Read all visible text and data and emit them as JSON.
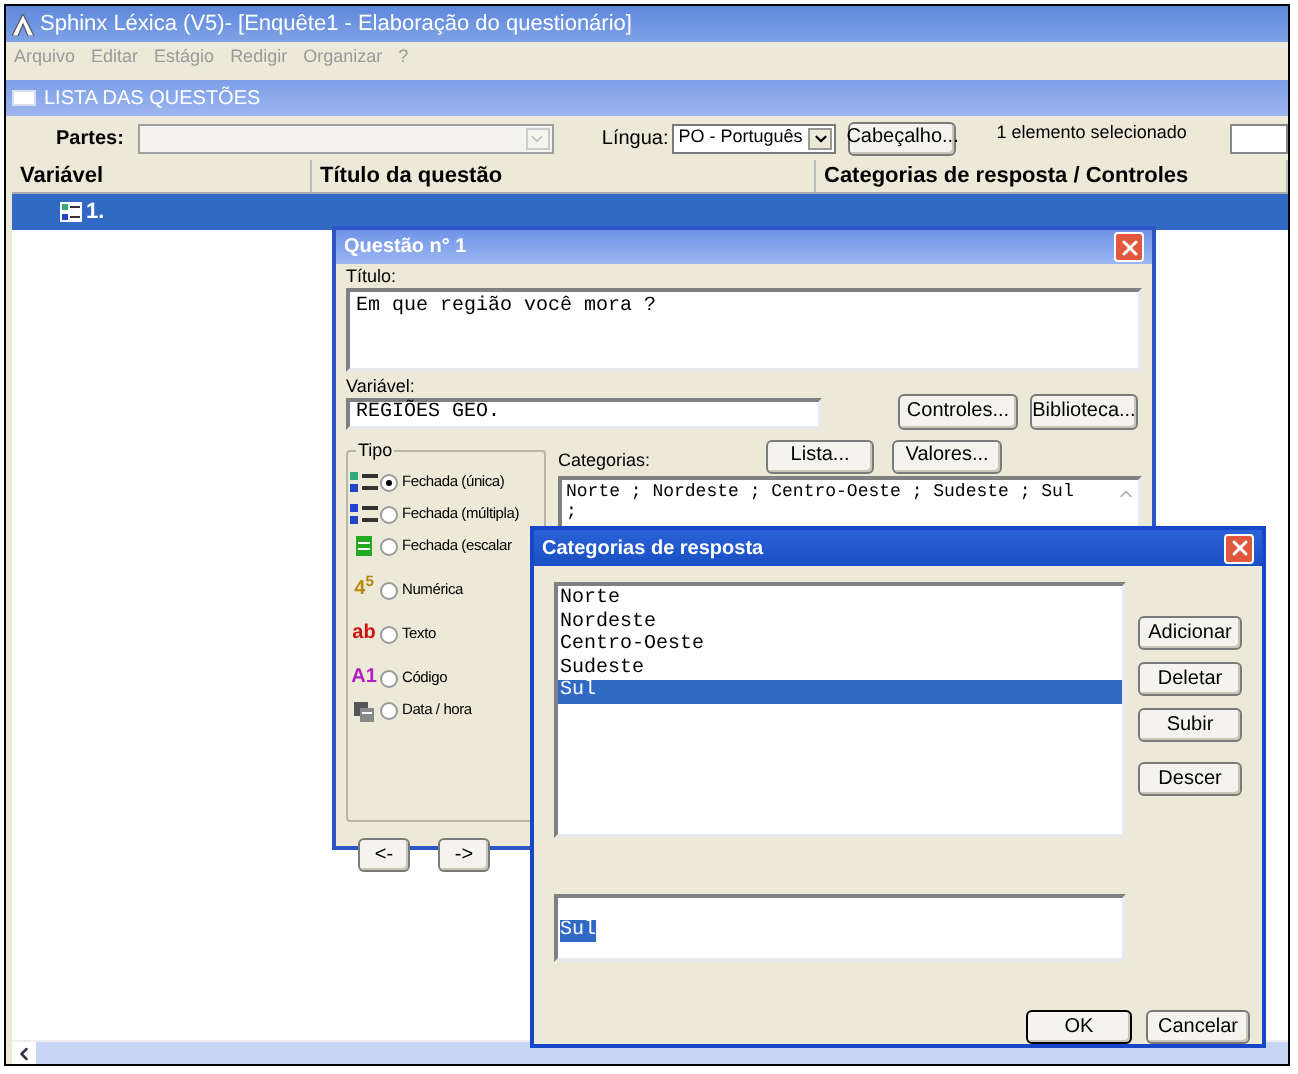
{
  "window": {
    "title": "Sphinx Léxica (V5)- [Enquête1 - Elaboração do questionário]"
  },
  "menu": [
    {
      "label": "Arquivo",
      "disabled": true
    },
    {
      "label": "Editar",
      "disabled": true
    },
    {
      "label": "Estágio",
      "disabled": true
    },
    {
      "label": "Redigir",
      "disabled": true
    },
    {
      "label": "Organizar",
      "disabled": true
    },
    {
      "label": "?",
      "disabled": true
    }
  ],
  "child_window": {
    "title": "LISTA DAS QUESTÕES"
  },
  "toolbar": {
    "parts_label": "Partes:",
    "language_label": "Língua:",
    "language_value": "PO - Português",
    "header_button": "Cabeçalho...",
    "selection_status": "1 elemento selecionado"
  },
  "table": {
    "columns": [
      "Variável",
      "Título da questão",
      "Categorias de resposta / Controles"
    ],
    "rows": [
      {
        "variable": "1.",
        "selected": true
      }
    ]
  },
  "question_dialog": {
    "title": "Questão n° 1",
    "title_label": "Título:",
    "title_value": "Em que região você mora ?",
    "variable_label": "Variável:",
    "variable_value": "REGIÕES GEO.",
    "controls_button": "Controles...",
    "library_button": "Biblioteca...",
    "type_group": "Tipo",
    "types": [
      {
        "kind": "single",
        "label": "Fechada (única)",
        "selected": true
      },
      {
        "kind": "multiple",
        "label": "Fechada (múltipla)",
        "selected": false
      },
      {
        "kind": "scale",
        "label": "Fechada (escalar",
        "selected": false
      },
      {
        "kind": "numeric",
        "icon_text": "4$^{5}$",
        "label": "Numérica",
        "selected": false
      },
      {
        "kind": "text",
        "icon_text": "ab",
        "label": "Texto",
        "selected": false
      },
      {
        "kind": "code",
        "icon_text": "A1",
        "label": "Código",
        "selected": false
      },
      {
        "kind": "datetime",
        "label": "Data / hora",
        "selected": false
      }
    ],
    "categories_label": "Categorias:",
    "list_button": "Lista...",
    "values_button": "Valores...",
    "categories_value": "Norte ; Nordeste ; Centro-Oeste ; Sudeste ; Sul",
    "categories_value_line_2": ";",
    "prev_button": "<-",
    "next_button": "->"
  },
  "categories_dialog": {
    "title": "Categorias de resposta",
    "items": [
      {
        "label": "Norte",
        "selected": false
      },
      {
        "label": "Nordeste",
        "selected": false
      },
      {
        "label": "Centro-Oeste",
        "selected": false
      },
      {
        "label": "Sudeste",
        "selected": false
      },
      {
        "label": "Sul",
        "selected": true
      }
    ],
    "edit_value": "Sul",
    "edit_value_selected": true,
    "side_buttons": [
      "Adicionar",
      "Deletar",
      "Subir",
      "Descer"
    ],
    "ok_button": "OK",
    "cancel_button": "Cancelar"
  }
}
